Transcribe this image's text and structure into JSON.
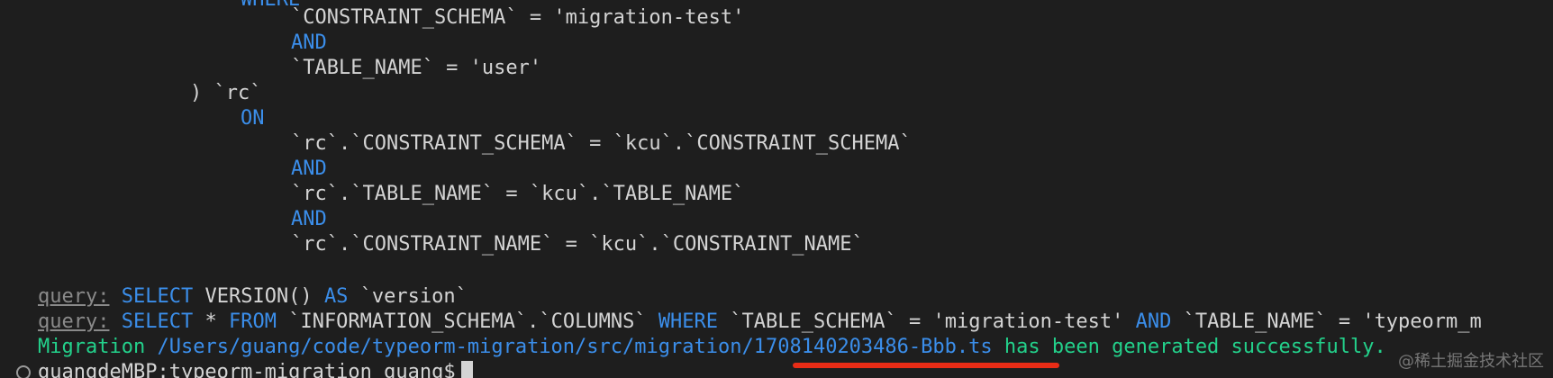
{
  "terminal": {
    "top_partial": "WHERE",
    "lines": [
      {
        "indent": "                 ",
        "text": "`CONSTRAINT_SCHEMA` = 'migration-test'"
      },
      {
        "indent": "                 ",
        "kw": "AND"
      },
      {
        "indent": "                 ",
        "text": "`TABLE_NAME` = 'user'"
      },
      {
        "indent": "         ",
        "text": ") `rc`"
      },
      {
        "indent": "             ",
        "kw": "ON"
      },
      {
        "indent": "                 ",
        "text": "`rc`.`CONSTRAINT_SCHEMA` = `kcu`.`CONSTRAINT_SCHEMA`"
      },
      {
        "indent": "                 ",
        "kw": "AND"
      },
      {
        "indent": "                 ",
        "text": "`rc`.`TABLE_NAME` = `kcu`.`TABLE_NAME`"
      },
      {
        "indent": "                 ",
        "kw": "AND"
      },
      {
        "indent": "                 ",
        "text": "`rc`.`CONSTRAINT_NAME` = `kcu`.`CONSTRAINT_NAME`"
      }
    ],
    "query1": {
      "label": "query:",
      "kw1": "SELECT",
      "rest1": "VERSION()",
      "kw2": "AS",
      "rest2": "`version`"
    },
    "query2": {
      "label": "query:",
      "kw1": "SELECT",
      "t1": "*",
      "kw2": "FROM",
      "t2": "`INFORMATION_SCHEMA`.`COLUMNS`",
      "kw3": "WHERE",
      "t3": "`TABLE_SCHEMA` = 'migration-test'",
      "kw4": "AND",
      "t4": "`TABLE_NAME` = 'typeorm_m"
    },
    "migration": {
      "prefix": "Migration",
      "path": "/Users/guang/code/typeorm-migration/src/migration/1708140203486-Bbb.ts",
      "suffix": "has been generated successfully."
    },
    "prompt": "guangdeMBP:typeorm-migration guang$"
  },
  "watermark": "@稀土掘金技术社区",
  "colors": {
    "background": "#1e1e1e",
    "keyword": "#3b8eea",
    "success": "#23d18b",
    "highlight_underline": "#e82c16"
  },
  "icons": {
    "prompt_marker": "circle-outline-icon"
  }
}
